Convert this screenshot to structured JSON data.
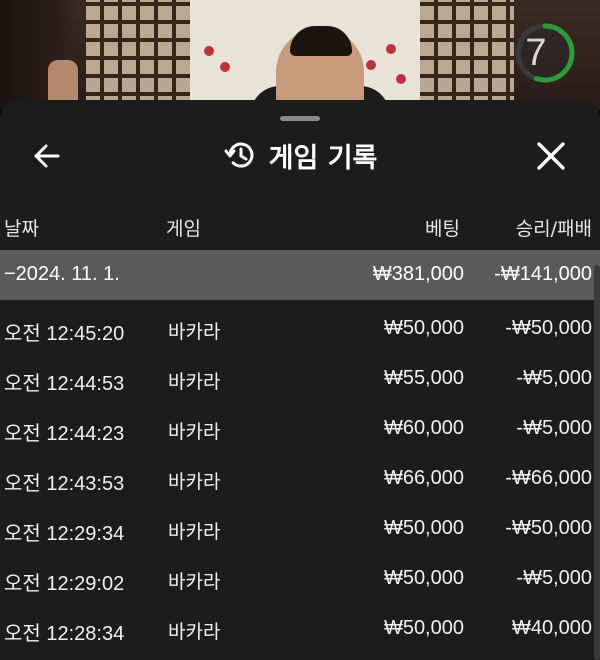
{
  "video": {
    "countdown": "7",
    "countdown_progress": 0.55,
    "accent_color": "#2e9b3a"
  },
  "sheet": {
    "title": "게임 기록",
    "title_icon": "history-icon",
    "back_icon": "arrow-left-icon",
    "close_icon": "close-icon"
  },
  "table": {
    "headers": {
      "date": "날짜",
      "game": "게임",
      "bet": "베팅",
      "result": "승리/패배"
    },
    "group": {
      "date": "−2024. 11. 1.",
      "bet": "₩381,000",
      "result": "-₩141,000",
      "background": "#5a5a5a"
    },
    "rows": [
      {
        "time": "오전 12:45:20",
        "game": "바카라",
        "bet": "₩50,000",
        "result": "-₩50,000"
      },
      {
        "time": "오전 12:44:53",
        "game": "바카라",
        "bet": "₩55,000",
        "result": "-₩5,000"
      },
      {
        "time": "오전 12:44:23",
        "game": "바카라",
        "bet": "₩60,000",
        "result": "-₩5,000"
      },
      {
        "time": "오전 12:43:53",
        "game": "바카라",
        "bet": "₩66,000",
        "result": "-₩66,000"
      },
      {
        "time": "오전 12:29:34",
        "game": "바카라",
        "bet": "₩50,000",
        "result": "-₩50,000"
      },
      {
        "time": "오전 12:29:02",
        "game": "바카라",
        "bet": "₩50,000",
        "result": "-₩5,000"
      },
      {
        "time": "오전 12:28:34",
        "game": "바카라",
        "bet": "₩50,000",
        "result": "₩40,000"
      }
    ]
  }
}
